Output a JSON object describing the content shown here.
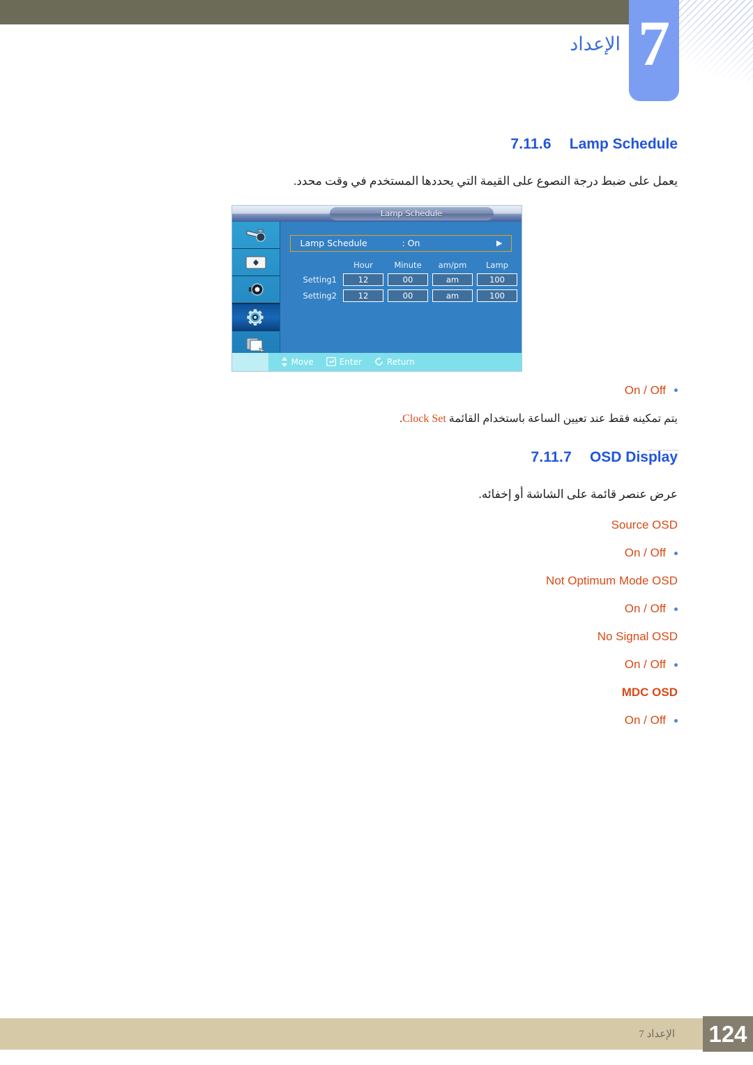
{
  "header": {
    "chapter_number": "7",
    "chapter_title": "الإعداد"
  },
  "sections": [
    {
      "number": "7.11.6",
      "label": "Lamp Schedule",
      "description_ar": "يعمل على ضبط درجة النصوع على القيمة التي يحددها المستخدم في وقت محدد.",
      "options": "On / Off",
      "note_ar_before": "يتم تمكينه فقط عند تعيين الساعة باستخدام القائمة ",
      "note_token": "Clock Set",
      "note_ar_after": "."
    },
    {
      "number": "7.11.7",
      "label": "OSD Display",
      "description_ar": "عرض عنصر قائمة على الشاشة أو إخفائه.",
      "items": [
        {
          "label": "Source OSD",
          "options": "On / Off",
          "bold": false
        },
        {
          "label": "Not Optimum Mode OSD",
          "options": "On / Off",
          "bold": false
        },
        {
          "label": "No Signal OSD",
          "options": "On / Off",
          "bold": false
        },
        {
          "label": "MDC OSD",
          "options": "On / Off",
          "bold": true
        }
      ]
    }
  ],
  "osd": {
    "title": "Lamp Schedule",
    "menu_row": {
      "label": "Lamp Schedule",
      "value": ": On",
      "arrow": "▶"
    },
    "columns": [
      "Hour",
      "Minute",
      "am/pm",
      "Lamp"
    ],
    "rows": [
      {
        "name": "Setting1",
        "hour": "12",
        "minute": "00",
        "ampm": "am",
        "lamp": "100"
      },
      {
        "name": "Setting2",
        "hour": "12",
        "minute": "00",
        "ampm": "am",
        "lamp": "100"
      }
    ],
    "sidebar_icons": [
      "input-source-icon",
      "picture-adjust-icon",
      "sound-speaker-icon",
      "setup-gear-icon",
      "multi-control-icon"
    ],
    "selected_sidebar_index": 3,
    "nav": [
      {
        "icon": "updown-arrow-icon",
        "label": "Move"
      },
      {
        "icon": "enter-key-icon",
        "label": "Enter"
      },
      {
        "icon": "return-arrow-icon",
        "label": "Return"
      }
    ]
  },
  "footer": {
    "text": "الإعداد 7",
    "page": "124"
  },
  "colors": {
    "heading_blue": "#2255dd",
    "accent_orange": "#d94a16",
    "bullet_blue": "#4a86d8",
    "header_olive": "#6b6b57",
    "tab_blue": "#7b9ef2",
    "footer_tan": "#d6c9a8",
    "footer_page_box": "#857e6e",
    "osd_blue": "#3480c4",
    "osd_highlight_border": "#d6a623",
    "osd_nav_cyan": "#7fe0ec"
  }
}
